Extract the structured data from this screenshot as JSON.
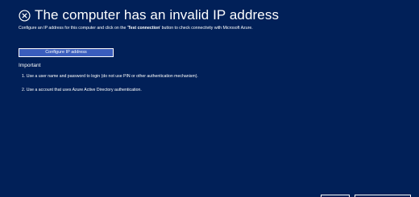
{
  "header": {
    "title": "The computer has an invalid IP address",
    "subtitle_before": "Configure an IP address for this computer and click on the '",
    "subtitle_bold": "Test connection",
    "subtitle_after": "' button to check connectivity with Microsoft Azure."
  },
  "actions": {
    "configure_label": "Configure IP address"
  },
  "important": {
    "heading": "Important",
    "items": [
      "1. Use a user name and password to login (do not use PIN or other authentication mechanism).",
      "2. Use a account that uses Azure Active Directory authentication."
    ]
  },
  "icons": {
    "title_icon": "circle-x-icon"
  },
  "colors": {
    "background": "#012058",
    "button": "#3a5dbd",
    "text": "#ffffff"
  }
}
